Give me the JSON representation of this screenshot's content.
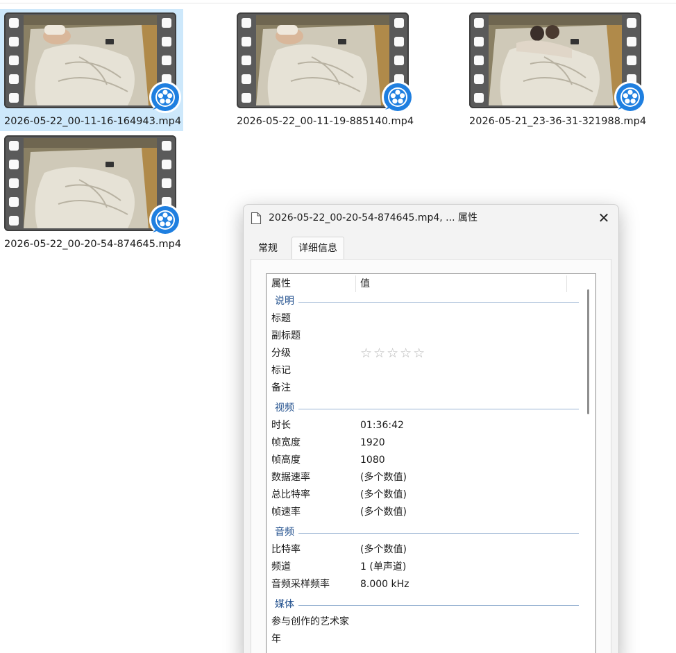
{
  "files": [
    {
      "name": "2026-05-22_00-11-16-164943.mp4",
      "selected": true,
      "scene": "sleeper"
    },
    {
      "name": "2026-05-22_00-11-19-885140.mp4",
      "selected": false,
      "scene": "sleeper"
    },
    {
      "name": "2026-05-21_23-36-31-321988.mp4",
      "selected": false,
      "scene": "couple"
    },
    {
      "name": "2026-05-22_00-20-54-874645.mp4",
      "selected": false,
      "scene": "empty"
    }
  ],
  "dialog": {
    "title": "2026-05-22_00-20-54-874645.mp4, ... 属性",
    "close_glyph": "✕",
    "tabs": [
      {
        "label": "常规",
        "active": false
      },
      {
        "label": "详细信息",
        "active": true
      }
    ],
    "columns": {
      "property": "属性",
      "value": "值"
    },
    "groups": {
      "description": {
        "label": "说明",
        "rows": [
          {
            "name": "标题",
            "value": ""
          },
          {
            "name": "副标题",
            "value": ""
          },
          {
            "name": "分级",
            "value": ""
          },
          {
            "name": "标记",
            "value": ""
          },
          {
            "name": "备注",
            "value": ""
          }
        ],
        "rating_stars": "☆☆☆☆☆",
        "rating_value": 0
      },
      "video": {
        "label": "视频",
        "rows": [
          {
            "name": "时长",
            "value": "01:36:42"
          },
          {
            "name": "帧宽度",
            "value": "1920"
          },
          {
            "name": "帧高度",
            "value": "1080"
          },
          {
            "name": "数据速率",
            "value": "(多个数值)"
          },
          {
            "name": "总比特率",
            "value": "(多个数值)"
          },
          {
            "name": "帧速率",
            "value": "(多个数值)"
          }
        ]
      },
      "audio": {
        "label": "音频",
        "rows": [
          {
            "name": "比特率",
            "value": "(多个数值)"
          },
          {
            "name": "频道",
            "value": "1 (单声道)"
          },
          {
            "name": "音频采样频率",
            "value": "8.000 kHz"
          }
        ]
      },
      "media": {
        "label": "媒体",
        "rows": [
          {
            "name": "参与创作的艺术家",
            "value": ""
          },
          {
            "name": "年",
            "value": ""
          }
        ]
      }
    }
  },
  "colors": {
    "selection": "#cde8fb",
    "group_label": "#1f4e8c",
    "badge_blue": "#1f7fe0"
  }
}
